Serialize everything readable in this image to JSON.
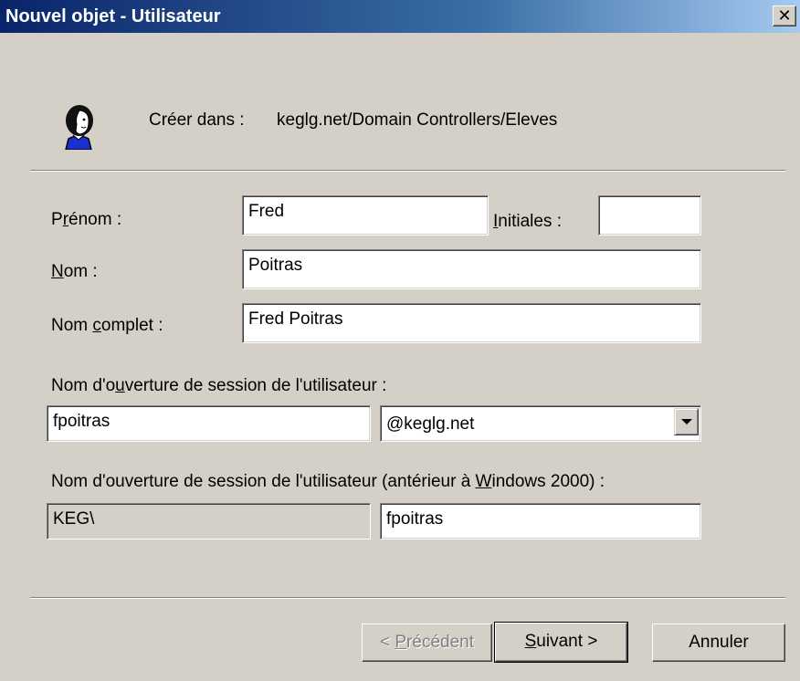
{
  "window": {
    "title": "Nouvel objet - Utilisateur"
  },
  "header": {
    "create_in_label": "Créer dans :",
    "create_in_path": "keglg.net/Domain Controllers/Eleves",
    "icon": "user-icon"
  },
  "form": {
    "first_name": {
      "label_pre": "P",
      "label_accel": "r",
      "label_post": "énom :",
      "value": "Fred"
    },
    "initials": {
      "label_accel": "I",
      "label_post": "nitiales :",
      "value": ""
    },
    "last_name": {
      "label_accel": "N",
      "label_post": "om :",
      "value": "Poitras"
    },
    "full_name": {
      "label_pre": "Nom ",
      "label_accel": "c",
      "label_post": "omplet :",
      "value": "Fred Poitras"
    },
    "logon": {
      "label_pre": "Nom d'o",
      "label_accel": "u",
      "label_post": "verture de session de l'utilisateur :",
      "value": "fpoitras",
      "domain": "@keglg.net"
    },
    "logon_pre2000": {
      "label_pre": "Nom d'ouverture de session de l'utilisateur (antérieur à ",
      "label_accel": "W",
      "label_post": "indows 2000) :",
      "domain_prefix": "KEG\\",
      "value": "fpoitras"
    }
  },
  "buttons": {
    "back": {
      "pre": "< ",
      "accel": "P",
      "post": "récédent"
    },
    "next": {
      "accel": "S",
      "post": "uivant >"
    },
    "cancel": {
      "label": "Annuler"
    }
  }
}
